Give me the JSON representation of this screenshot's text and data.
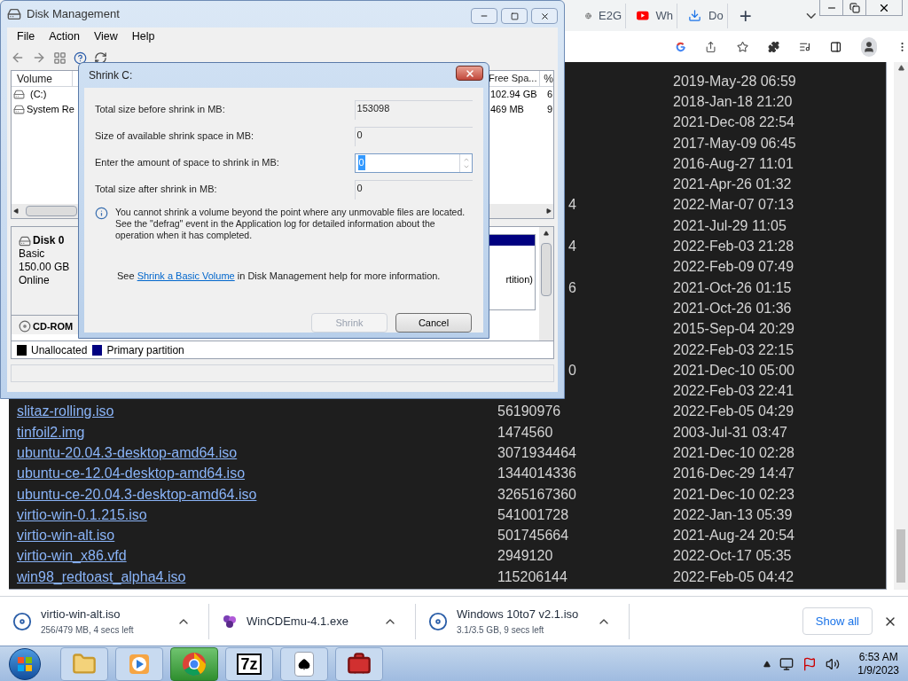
{
  "browser": {
    "tabs": [
      {
        "label": "E2G",
        "kind": "globe"
      },
      {
        "label": "Wh",
        "kind": "video"
      },
      {
        "label": "Do",
        "kind": "download"
      }
    ],
    "new_tab": "+",
    "rows": [
      {
        "date": "2019-May-28 06:59"
      },
      {
        "date": "2018-Jan-18 21:20"
      },
      {
        "date": "2021-Dec-08 22:54"
      },
      {
        "date": "2017-May-09 06:45"
      },
      {
        "date": "2016-Aug-27 11:01"
      },
      {
        "date": "2021-Apr-26 01:32"
      },
      {
        "size_fragment": "4",
        "date": "2022-Mar-07 07:13"
      },
      {
        "date": "2021-Jul-29 11:05"
      },
      {
        "size_fragment": "4",
        "date": "2022-Feb-03 21:28"
      },
      {
        "date": "2022-Feb-09 07:49"
      },
      {
        "size_fragment": "6",
        "date": "2021-Oct-26 01:15"
      },
      {
        "date": "2021-Oct-26 01:36"
      },
      {
        "date": "2015-Sep-04 20:29"
      },
      {
        "date": "2022-Feb-03 22:15"
      },
      {
        "size_fragment": "0",
        "date": "2021-Dec-10 05:00"
      },
      {
        "date": "2022-Feb-03 22:41"
      },
      {
        "name": "slitaz-rolling.iso",
        "size": "56190976",
        "date": "2022-Feb-05 04:29"
      },
      {
        "name": "tinfoil2.img",
        "size": "1474560",
        "date": "2003-Jul-31 03:47"
      },
      {
        "name": "ubuntu-20.04.3-desktop-amd64.iso",
        "size": "3071934464",
        "date": "2021-Dec-10 02:28"
      },
      {
        "name": "ubuntu-ce-12.04-desktop-amd64.iso",
        "size": "1344014336",
        "date": "2016-Dec-29 14:47"
      },
      {
        "name": "ubuntu-ce-20.04.3-desktop-amd64.iso",
        "size": "3265167360",
        "date": "2021-Dec-10 02:23"
      },
      {
        "name": "virtio-win-0.1.215.iso",
        "size": "541001728",
        "date": "2022-Jan-13 05:39"
      },
      {
        "name": "virtio-win-alt.iso",
        "size": "501745664",
        "date": "2021-Aug-24 20:54"
      },
      {
        "name": "virtio-win_x86.vfd",
        "size": "2949120",
        "date": "2022-Oct-17 05:35"
      },
      {
        "name": "win98_redtoast_alpha4.iso",
        "size": "115206144",
        "date": "2022-Feb-05 04:42"
      }
    ],
    "downloads": [
      {
        "name": "virtio-win-alt.iso",
        "status": "256/479 MB, 4 secs left",
        "kind": "disc"
      },
      {
        "name": "WinCDEmu-4.1.exe",
        "kind": "app"
      },
      {
        "name": "Windows 10to7 v2.1.iso",
        "status": "3.1/3.5 GB, 9 secs left",
        "kind": "disc"
      }
    ],
    "show_all": "Show all"
  },
  "disk_management": {
    "title": "Disk Management",
    "menu": [
      "File",
      "Action",
      "View",
      "Help"
    ],
    "columns": [
      "Volume",
      "Free Spa...",
      "%"
    ],
    "volumes": [
      {
        "name": "(C:)",
        "free": "102.94 GB",
        "percent": "6"
      },
      {
        "name": "System Re",
        "free": "469 MB",
        "percent": "9"
      }
    ],
    "disk": {
      "name": "Disk 0",
      "type": "Basic",
      "size": "150.00 GB",
      "status": "Online",
      "partition_fragment": "rtition)"
    },
    "cdrom": "CD-ROM",
    "legend": [
      {
        "label": "Unallocated",
        "color": "#000000"
      },
      {
        "label": "Primary partition",
        "color": "#000080"
      }
    ]
  },
  "dialog": {
    "title": "Shrink C:",
    "fields": [
      {
        "label": "Total size before shrink in MB:",
        "value": "153098",
        "kind": "readonly"
      },
      {
        "label": "Size of available shrink space in MB:",
        "value": "0",
        "kind": "readonly"
      },
      {
        "label": "Enter the amount of space to shrink in MB:",
        "value": "0",
        "kind": "spin"
      },
      {
        "label": "Total size after shrink in MB:",
        "value": "0",
        "kind": "readonly"
      }
    ],
    "info": "You cannot shrink a volume beyond the point where any unmovable files are located. See the \"defrag\" event in the Application log for detailed information about the operation when it has completed.",
    "help_before": "See",
    "help_link": "Shrink a Basic Volume",
    "help_after": "in Disk Management help for more information.",
    "buttons": [
      {
        "label": "Shrink",
        "disabled": true
      },
      {
        "label": "Cancel",
        "disabled": false
      }
    ]
  },
  "taskbar": {
    "apps": [
      {
        "kind": "folder",
        "selected": false
      },
      {
        "kind": "media",
        "selected": false
      },
      {
        "kind": "chrome",
        "selected": true
      },
      {
        "kind": "archiver",
        "label": "7z",
        "selected": false
      },
      {
        "kind": "cards",
        "selected": false
      },
      {
        "kind": "toolbox",
        "selected": false
      }
    ],
    "time": "6:53 AM",
    "date": "1/9/2023"
  }
}
